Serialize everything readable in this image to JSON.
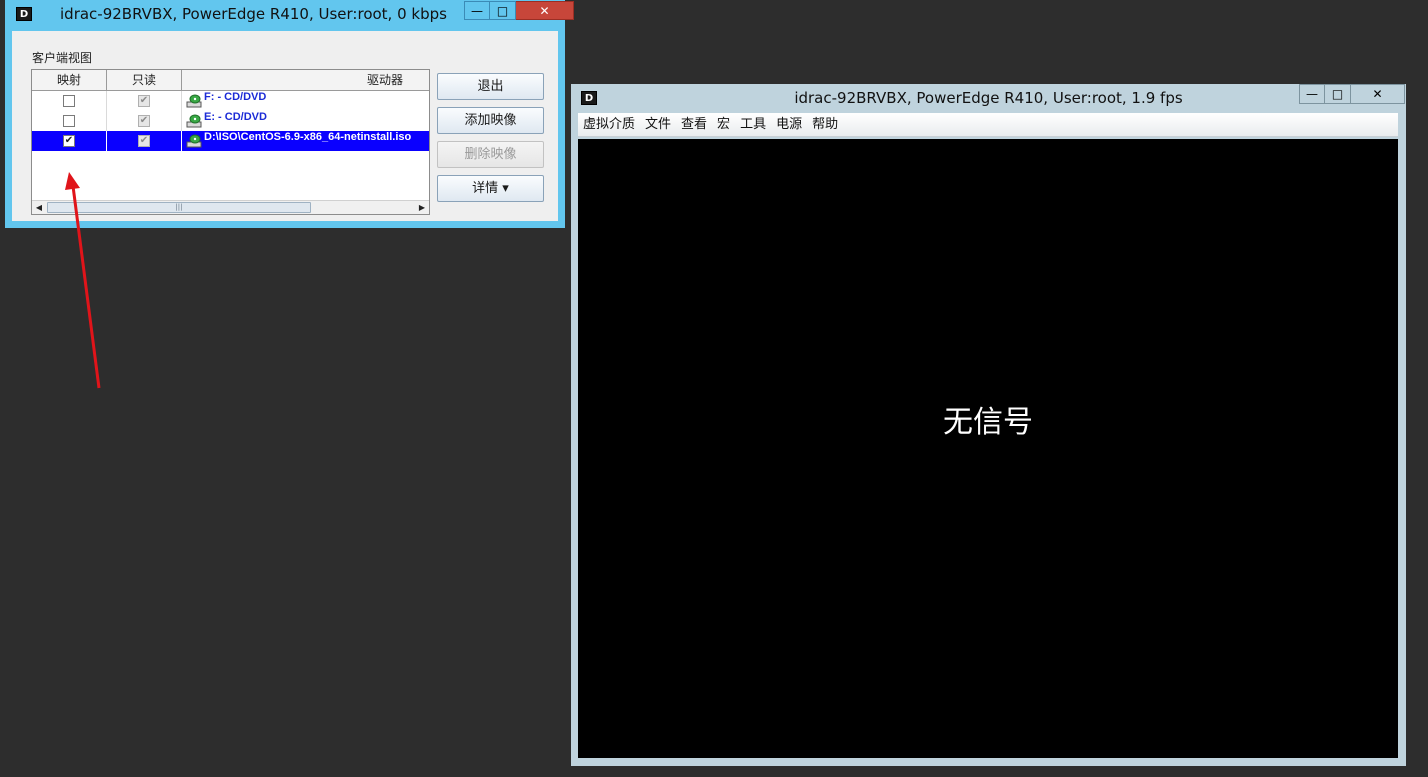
{
  "virtual_media_window": {
    "icon_letter": "D",
    "title": "idrac-92BRVBX, PowerEdge R410, User:root, 0 kbps",
    "controls": {
      "minimize": "—",
      "maximize": "□",
      "close": "✕"
    },
    "section_label": "客户端视图",
    "table": {
      "headers": [
        "映射",
        "只读",
        "驱动器"
      ],
      "rows": [
        {
          "mapped": false,
          "readonly": true,
          "drive": "F: - CD/DVD",
          "selected": false
        },
        {
          "mapped": false,
          "readonly": true,
          "drive": "E: - CD/DVD",
          "selected": false
        },
        {
          "mapped": true,
          "readonly": true,
          "drive": "D:\\ISO\\CentOS-6.9-x86_64-netinstall.iso",
          "selected": true
        }
      ]
    },
    "buttons": {
      "exit": "退出",
      "add_image": "添加映像",
      "remove_image": "删除映像",
      "details": "详情 ▾"
    }
  },
  "console_window": {
    "icon_letter": "D",
    "title": "idrac-92BRVBX, PowerEdge R410, User:root, 1.9 fps",
    "controls": {
      "minimize": "—",
      "maximize": "□",
      "close": "✕"
    },
    "menu": [
      "虚拟介质",
      "文件",
      "查看",
      "宏",
      "工具",
      "电源",
      "帮助"
    ],
    "screen_message": "无信号"
  },
  "colors": {
    "desktop": "#2d2d2d",
    "vm_frame": "#62c6ee",
    "console_frame": "#bfd3dd",
    "selection": "#0a00ff",
    "arrow": "#e0141a"
  }
}
